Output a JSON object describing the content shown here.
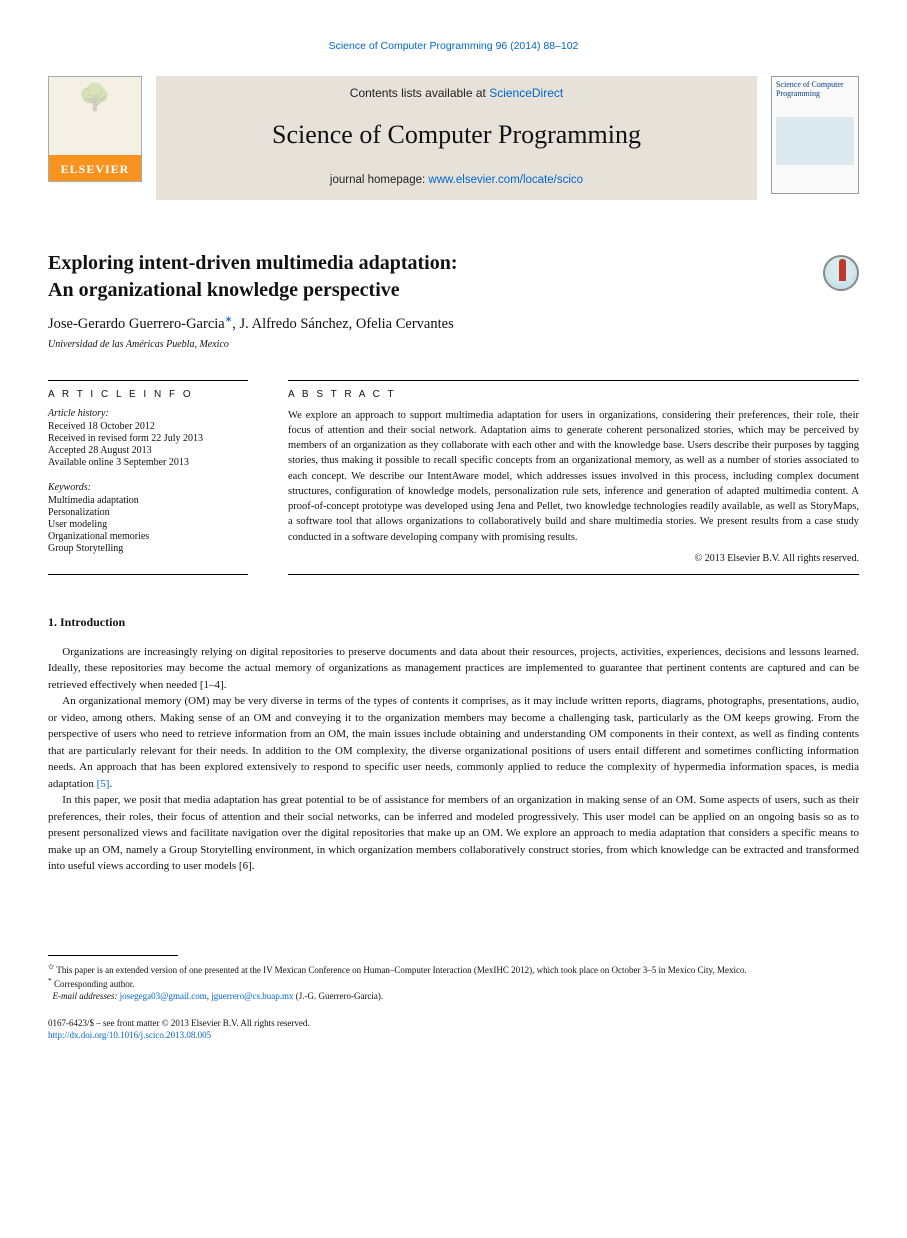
{
  "citation": "Science of Computer Programming 96 (2014) 88–102",
  "header": {
    "contents_prefix": "Contents lists available at ",
    "contents_link": "ScienceDirect",
    "journal_name": "Science of Computer Programming",
    "homepage_prefix": "journal homepage: ",
    "homepage_url": "www.elsevier.com/locate/scico",
    "elsevier": "ELSEVIER",
    "cover_title": "Science of Computer Programming"
  },
  "title": "Exploring intent-driven multimedia adaptation:\nAn organizational knowledge perspective",
  "authors_pre": "Jose-Gerardo Guerrero-Garcia",
  "authors_post": ", J. Alfredo Sánchez, Ofelia Cervantes",
  "affiliation": "Universidad de las Américas Puebla, Mexico",
  "info": {
    "heading": "A R T I C L E   I N F O",
    "history_label": "Article history:",
    "history": [
      "Received 18 October 2012",
      "Received in revised form 22 July 2013",
      "Accepted 28 August 2013",
      "Available online 3 September 2013"
    ],
    "keywords_label": "Keywords:",
    "keywords": [
      "Multimedia adaptation",
      "Personalization",
      "User modeling",
      "Organizational memories",
      "Group Storytelling"
    ]
  },
  "abstract": {
    "heading": "A B S T R A C T",
    "text": "We explore an approach to support multimedia adaptation for users in organizations, considering their preferences, their role, their focus of attention and their social network. Adaptation aims to generate coherent personalized stories, which may be perceived by members of an organization as they collaborate with each other and with the knowledge base. Users describe their purposes by tagging stories, thus making it possible to recall specific concepts from an organizational memory, as well as a number of stories associated to each concept. We describe our IntentAware model, which addresses issues involved in this process, including complex document structures, configuration of knowledge models, personalization rule sets, inference and generation of adapted multimedia content. A proof-of-concept prototype was developed using Jena and Pellet, two knowledge technologies readily available, as well as StoryMaps, a software tool that allows organizations to collaboratively build and share multimedia stories. We present results from a case study conducted in a software developing company with promising results.",
    "copyright": "© 2013 Elsevier B.V. All rights reserved."
  },
  "section1": {
    "num": "1.",
    "title": "Introduction",
    "paras": [
      "Organizations are increasingly relying on digital repositories to preserve documents and data about their resources, projects, activities, experiences, decisions and lessons learned. Ideally, these repositories may become the actual memory of organizations as management practices are implemented to guarantee that pertinent contents are captured and can be retrieved effectively when needed [1–4].",
      "An organizational memory (OM) may be very diverse in terms of the types of contents it comprises, as it may include written reports, diagrams, photographs, presentations, audio, or video, among others. Making sense of an OM and conveying it to the organization members may become a challenging task, particularly as the OM keeps growing. From the perspective of users who need to retrieve information from an OM, the main issues include obtaining and understanding OM components in their context, as well as finding contents that are particularly relevant for their needs. In addition to the OM complexity, the diverse organizational positions of users entail different and sometimes conflicting information needs. An approach that has been explored extensively to respond to specific user needs, commonly applied to reduce the complexity of hypermedia information spaces, is media adaptation [5].",
      "In this paper, we posit that media adaptation has great potential to be of assistance for members of an organization in making sense of an OM. Some aspects of users, such as their preferences, their roles, their focus of attention and their social networks, can be inferred and modeled progressively. This user model can be applied on an ongoing basis so as to present personalized views and facilitate navigation over the digital repositories that make up an OM. We explore an approach to media adaptation that considers a specific means to make up an OM, namely a Group Storytelling environment, in which organization members collaboratively construct stories, from which knowledge can be extracted and transformed into useful views according to user models [6]."
    ]
  },
  "footnotes": {
    "star": "This paper is an extended version of one presented at the IV Mexican Conference on Human–Computer Interaction (MexIHC 2012), which took place on October 3–5 in Mexico City, Mexico.",
    "corr_label": "Corresponding author.",
    "email_label": "E-mail addresses:",
    "email1": "josegega03@gmail.com",
    "email1_suffix": ", ",
    "email2": "jguerrero@cs.buap.mx",
    "email_suffix": " (J.-G. Guerrero-Garcia)."
  },
  "footer": {
    "line1_pre": "0167-6423/$ – see front matter ",
    "line1_post": "© 2013 Elsevier B.V. All rights reserved.",
    "doi": "http://dx.doi.org/10.1016/j.scico.2013.08.005"
  }
}
